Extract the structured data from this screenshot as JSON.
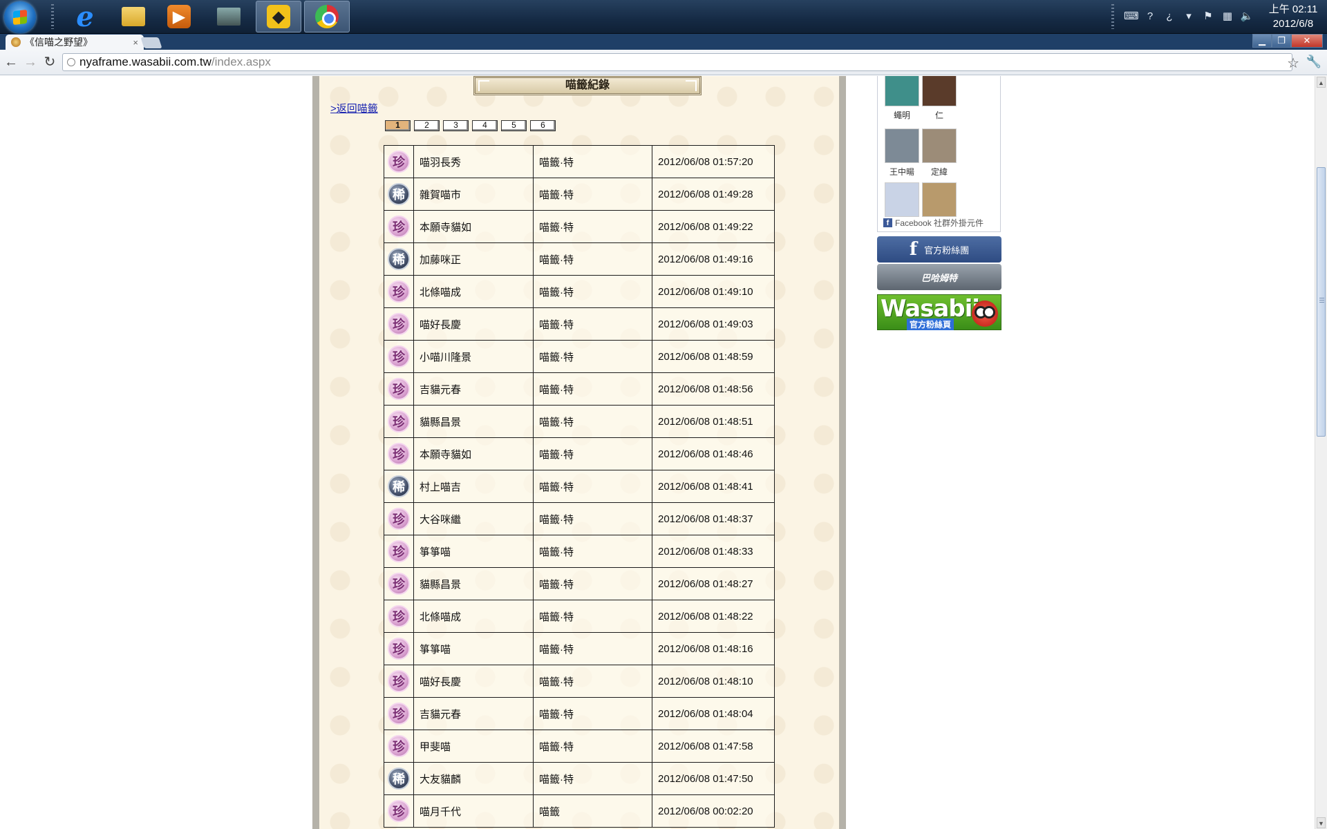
{
  "taskbar": {
    "apps": [
      {
        "name": "internet-explorer",
        "icon": "ie-icon"
      },
      {
        "name": "file-explorer",
        "icon": "folder-icon"
      },
      {
        "name": "media-player",
        "icon": "media-player-icon"
      },
      {
        "name": "remote-desktop",
        "icon": "monitor-icon"
      },
      {
        "name": "game-launcher",
        "icon": "yellow-app-icon"
      },
      {
        "name": "chrome",
        "icon": "chrome-icon"
      }
    ],
    "clock_time": "上午 02:11",
    "clock_date": "2012/6/8"
  },
  "browser": {
    "tab_title": "《信喵之野望》",
    "tab_close": "×",
    "url_host": "nyaframe.wasabii.com.tw",
    "url_path": "/index.aspx",
    "win_min": "▁",
    "win_max": "❐",
    "win_close": "✕"
  },
  "page": {
    "title": "喵籤紀錄",
    "back_link": ">返回喵籤",
    "pages": [
      "1",
      "2",
      "3",
      "4",
      "5",
      "6"
    ],
    "active_page": "1",
    "records": [
      {
        "badge": "珍",
        "rarity": "zhen",
        "name": "喵羽長秀",
        "type": "喵籤·特",
        "time": "2012/06/08 01:57:20"
      },
      {
        "badge": "稀",
        "rarity": "xi",
        "name": "雜賀喵市",
        "type": "喵籤·特",
        "time": "2012/06/08 01:49:28"
      },
      {
        "badge": "珍",
        "rarity": "zhen",
        "name": "本願寺貓如",
        "type": "喵籤·特",
        "time": "2012/06/08 01:49:22"
      },
      {
        "badge": "稀",
        "rarity": "xi",
        "name": "加藤咪正",
        "type": "喵籤·特",
        "time": "2012/06/08 01:49:16"
      },
      {
        "badge": "珍",
        "rarity": "zhen",
        "name": "北條喵成",
        "type": "喵籤·特",
        "time": "2012/06/08 01:49:10"
      },
      {
        "badge": "珍",
        "rarity": "zhen",
        "name": "喵好長慶",
        "type": "喵籤·特",
        "time": "2012/06/08 01:49:03"
      },
      {
        "badge": "珍",
        "rarity": "zhen",
        "name": "小喵川隆景",
        "type": "喵籤·特",
        "time": "2012/06/08 01:48:59"
      },
      {
        "badge": "珍",
        "rarity": "zhen",
        "name": "吉貓元春",
        "type": "喵籤·特",
        "time": "2012/06/08 01:48:56"
      },
      {
        "badge": "珍",
        "rarity": "zhen",
        "name": "貓縣昌景",
        "type": "喵籤·特",
        "time": "2012/06/08 01:48:51"
      },
      {
        "badge": "珍",
        "rarity": "zhen",
        "name": "本願寺貓如",
        "type": "喵籤·特",
        "time": "2012/06/08 01:48:46"
      },
      {
        "badge": "稀",
        "rarity": "xi",
        "name": "村上喵吉",
        "type": "喵籤·特",
        "time": "2012/06/08 01:48:41"
      },
      {
        "badge": "珍",
        "rarity": "zhen",
        "name": "大谷咪繼",
        "type": "喵籤·特",
        "time": "2012/06/08 01:48:37"
      },
      {
        "badge": "珍",
        "rarity": "zhen",
        "name": "箏箏喵",
        "type": "喵籤·特",
        "time": "2012/06/08 01:48:33"
      },
      {
        "badge": "珍",
        "rarity": "zhen",
        "name": "貓縣昌景",
        "type": "喵籤·特",
        "time": "2012/06/08 01:48:27"
      },
      {
        "badge": "珍",
        "rarity": "zhen",
        "name": "北條喵成",
        "type": "喵籤·特",
        "time": "2012/06/08 01:48:22"
      },
      {
        "badge": "珍",
        "rarity": "zhen",
        "name": "箏箏喵",
        "type": "喵籤·特",
        "time": "2012/06/08 01:48:16"
      },
      {
        "badge": "珍",
        "rarity": "zhen",
        "name": "喵好長慶",
        "type": "喵籤·特",
        "time": "2012/06/08 01:48:10"
      },
      {
        "badge": "珍",
        "rarity": "zhen",
        "name": "吉貓元春",
        "type": "喵籤·特",
        "time": "2012/06/08 01:48:04"
      },
      {
        "badge": "珍",
        "rarity": "zhen",
        "name": "甲斐喵",
        "type": "喵籤·特",
        "time": "2012/06/08 01:47:58"
      },
      {
        "badge": "稀",
        "rarity": "xi",
        "name": "大友貓麟",
        "type": "喵籤·特",
        "time": "2012/06/08 01:47:50"
      },
      {
        "badge": "珍",
        "rarity": "zhen",
        "name": "喵月千代",
        "type": "喵籤",
        "time": "2012/06/08 00:02:20"
      }
    ]
  },
  "sidebar": {
    "friends": [
      {
        "name": "蠅明",
        "color": "#3f8f8a"
      },
      {
        "name": "仁",
        "color": "#5a3b2a"
      },
      {
        "name": "王中暘",
        "color": "#7d8a96"
      },
      {
        "name": "定緯",
        "color": "#9c8c78"
      },
      {
        "name": "",
        "color": "#c9d3e6"
      },
      {
        "name": "",
        "color": "#b89a6c"
      }
    ],
    "fb_footer": "Facebook 社群外掛元件",
    "fb_fanpage": "官方粉絲團",
    "bahamut": "巴哈姆特",
    "wasabii_logo": "Wasabii",
    "wasabii_sub": "官方粉絲頁"
  }
}
